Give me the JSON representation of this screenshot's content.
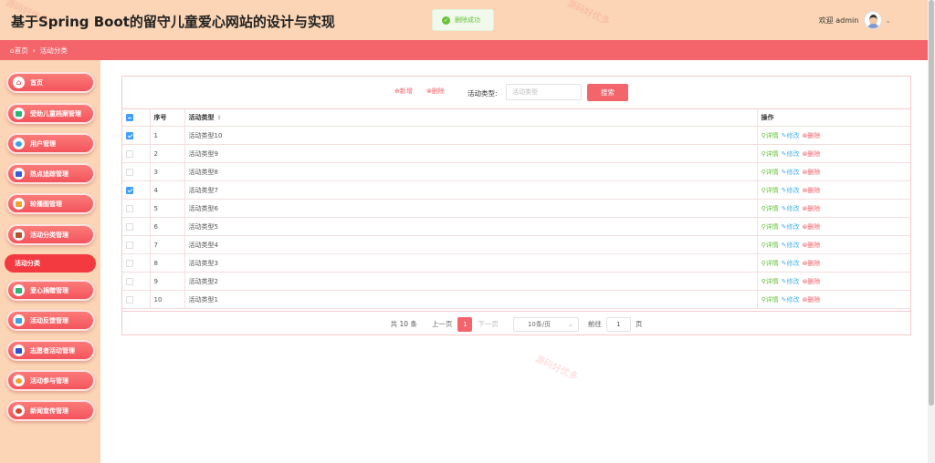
{
  "app": {
    "title": "基于Spring Boot的留守儿童爱心网站的设计与实现",
    "welcome": "欢迎 admin",
    "chevron": "⌄"
  },
  "toast": {
    "text": "删除成功"
  },
  "breadcrumb": {
    "home": "首页",
    "current": "活动分类"
  },
  "sidebar": {
    "items": [
      {
        "label": "首页",
        "icon": "home-icon"
      },
      {
        "label": "受助儿童档案管理",
        "icon": "folder-icon"
      },
      {
        "label": "用户管理",
        "icon": "user-icon"
      },
      {
        "label": "热点追踪管理",
        "icon": "hotspot-icon"
      },
      {
        "label": "轮播图管理",
        "icon": "carousel-icon"
      },
      {
        "label": "活动分类管理",
        "icon": "category-icon"
      },
      {
        "label": "活动分类",
        "icon": ""
      },
      {
        "label": "爱心捐赠管理",
        "icon": "donation-icon"
      },
      {
        "label": "活动反馈管理",
        "icon": "feedback-icon"
      },
      {
        "label": "志愿者活动管理",
        "icon": "volunteer-icon"
      },
      {
        "label": "活动参与管理",
        "icon": "participation-icon"
      },
      {
        "label": "新闻宣传管理",
        "icon": "news-icon"
      }
    ]
  },
  "toolbar": {
    "add": "⊕新增",
    "delete": "⊗删除",
    "type_label": "活动类型:",
    "type_placeholder": "活动类型",
    "search": "搜索"
  },
  "table": {
    "headers": {
      "no": "序号",
      "type": "活动类型",
      "ops": "操作",
      "sort": "⇕"
    },
    "ops": {
      "detail": "详情",
      "edit": "修改",
      "delete": "删除"
    },
    "rows": [
      {
        "no": "1",
        "type": "活动类型10",
        "checked": true
      },
      {
        "no": "2",
        "type": "活动类型9",
        "checked": false
      },
      {
        "no": "3",
        "type": "活动类型8",
        "checked": false
      },
      {
        "no": "4",
        "type": "活动类型7",
        "checked": true
      },
      {
        "no": "5",
        "type": "活动类型6",
        "checked": false
      },
      {
        "no": "6",
        "type": "活动类型5",
        "checked": false
      },
      {
        "no": "7",
        "type": "活动类型4",
        "checked": false
      },
      {
        "no": "8",
        "type": "活动类型3",
        "checked": false
      },
      {
        "no": "9",
        "type": "活动类型2",
        "checked": false
      },
      {
        "no": "10",
        "type": "活动类型1",
        "checked": false
      }
    ]
  },
  "pager": {
    "total": "共 10 条",
    "prev": "上一页",
    "page": "1",
    "next": "下一页",
    "size": "10条/页",
    "goto": "前往",
    "goto_value": "1",
    "unit": "页"
  },
  "watermark": "源码好优多",
  "colors": {
    "accent": "#f4646b",
    "header": "#fbd5b5",
    "success": "#67c23a",
    "info": "#4db3e8"
  }
}
